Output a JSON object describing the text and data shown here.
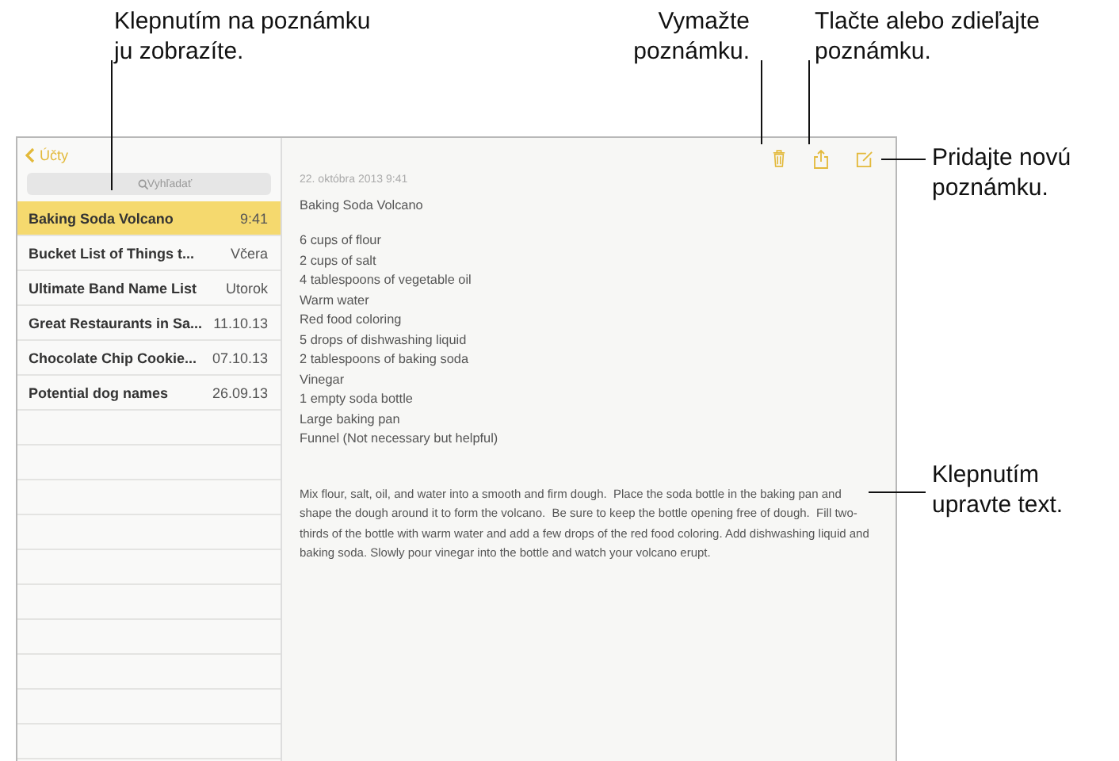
{
  "callouts": [
    {
      "kind": "top-left",
      "text": "Klepnutím na poznámku\nju zobrazíte."
    },
    {
      "kind": "top-delete",
      "text": "Vymažte\npoznámku."
    },
    {
      "kind": "top-share",
      "text": "Tlačte alebo zdieľajte\npoznámku."
    },
    {
      "kind": "right-new",
      "text": "Pridajte novú\npoznámku."
    },
    {
      "kind": "right-edit",
      "text": "Klepnutím\nupravte text."
    }
  ],
  "sidebar": {
    "back": "Účty",
    "search": {
      "placeholder": "Vyhľadať"
    },
    "notes": [
      {
        "title": "Baking Soda Volcano",
        "date": "9:41",
        "selected": true
      },
      {
        "title": "Bucket List of Things t...",
        "date": "Včera",
        "selected": false
      },
      {
        "title": "Ultimate Band Name List",
        "date": "Utorok",
        "selected": false
      },
      {
        "title": "Great Restaurants in Sa...",
        "date": "11.10.13",
        "selected": false
      },
      {
        "title": "Chocolate Chip Cookie...",
        "date": "07.10.13",
        "selected": false
      },
      {
        "title": "Potential dog names",
        "date": "26.09.13",
        "selected": false
      }
    ]
  },
  "note": {
    "toolbar": [
      {
        "kind": "trash"
      },
      {
        "kind": "share"
      },
      {
        "kind": "compose"
      }
    ],
    "timestamp": "22. októbra 2013 9:41",
    "title": "Baking Soda Volcano",
    "lines": [
      "6 cups of flour",
      "2 cups of salt",
      "4 tablespoons of vegetable oil",
      "Warm water",
      "Red food coloring",
      "5 drops of dishwashing liquid",
      "2 tablespoons of baking soda",
      "Vinegar",
      "1 empty soda bottle",
      "Large baking pan",
      "Funnel (Not necessary but helpful)"
    ],
    "paragraph": "Mix flour, salt, oil, and water into a smooth and firm dough.  Place the soda bottle in the baking pan and shape the dough around it to form the volcano.  Be sure to keep the bottle opening free of dough.  Fill two-thirds of the bottle with warm water and add a few drops of the red food coloring. Add dishwashing liquid and baking soda. Slowly pour vinegar into the bottle and watch your volcano erupt."
  }
}
